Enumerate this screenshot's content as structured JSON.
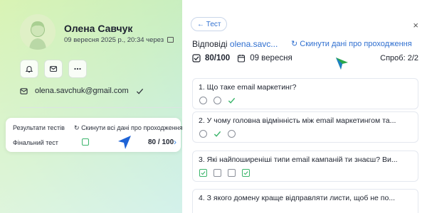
{
  "profile": {
    "name": "Олена Савчук",
    "meta": "09 вересня 2025 р., 20:34 через",
    "email": "olena.savchuk@gmail.com"
  },
  "results": {
    "title": "Результати тестів",
    "reset_all": "Скинути всі дані про проходження",
    "test_name": "Фінальний тест",
    "score": "80 / 100"
  },
  "panel": {
    "back_label": "← Тест",
    "close": "×",
    "answers_label": "Відповіді",
    "answers_email": "olena.savc...",
    "reset": "Скинути дані про проходження",
    "score": "80/100",
    "date": "09 вересня",
    "attempts": "Спроб: 2/2",
    "questions": [
      {
        "text": "1. Що таке email маркетинг?",
        "type": "radio",
        "options": [
          "radio",
          "radio",
          "check"
        ]
      },
      {
        "text": "2. У чому головна відмінність між email маркетингом та...",
        "type": "radio",
        "options": [
          "radio",
          "check",
          "radio"
        ]
      },
      {
        "text": "3. Які найпоширеніші типи email кампаній ти знаєш? Ви...",
        "type": "checkbox",
        "options": [
          "box-ok",
          "box",
          "box",
          "box-ok"
        ]
      },
      {
        "text": "4. З якого домену краще відправляти листи, щоб не по...",
        "type": "radio",
        "options": []
      }
    ]
  },
  "colors": {
    "accent": "#2f6fd0",
    "success": "#3bb56b",
    "cursor": "#1e63d6",
    "cursor2": "#2aa84a"
  }
}
